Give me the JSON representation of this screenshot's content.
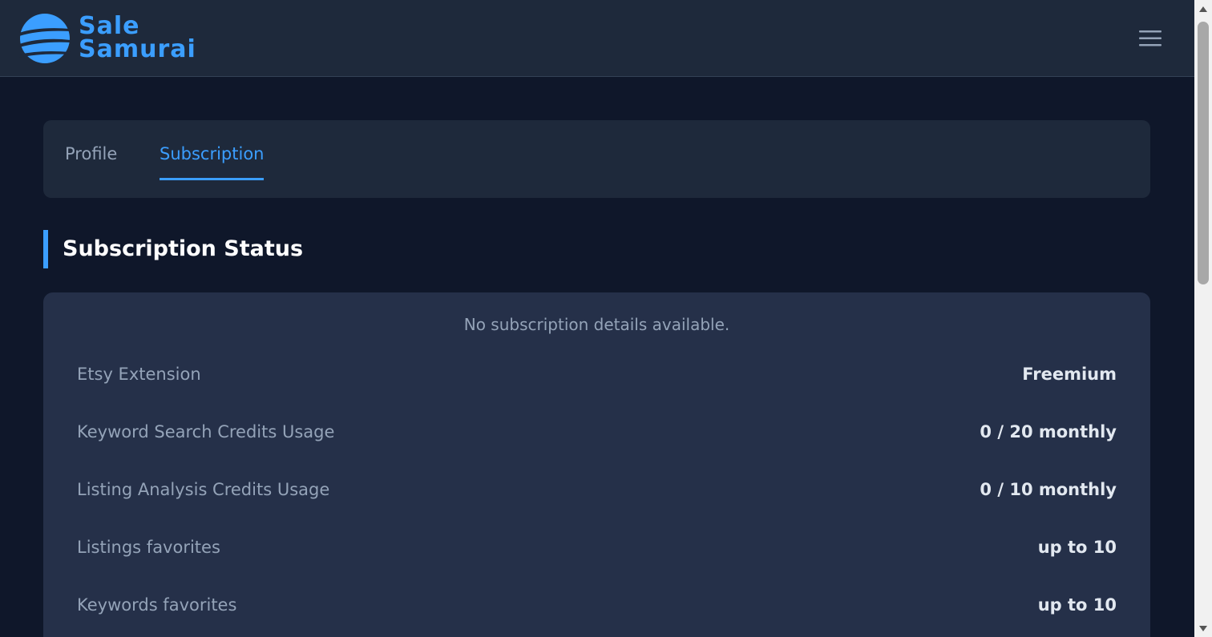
{
  "app": {
    "logo_line1": "Sale",
    "logo_line2": "Samurai",
    "brand_color": "#3b9eff"
  },
  "header": {
    "menu_icon": "hamburger-menu-icon"
  },
  "tabs": [
    {
      "label": "Profile",
      "active": false
    },
    {
      "label": "Subscription",
      "active": true
    }
  ],
  "section": {
    "title": "Subscription Status"
  },
  "subscription": {
    "empty_message": "No subscription details available.",
    "rows": [
      {
        "label": "Etsy Extension",
        "value": "Freemium"
      },
      {
        "label": "Keyword Search Credits Usage",
        "value": "0 / 20 monthly"
      },
      {
        "label": "Listing Analysis Credits Usage",
        "value": "0 / 10 monthly"
      },
      {
        "label": "Listings favorites",
        "value": "up to 10"
      },
      {
        "label": "Keywords favorites",
        "value": "up to 10"
      }
    ]
  },
  "colors": {
    "background": "#0f172a",
    "header": "#1e293b",
    "card": "#253049",
    "accent": "#3b9eff",
    "muted_text": "#94a3b8"
  }
}
